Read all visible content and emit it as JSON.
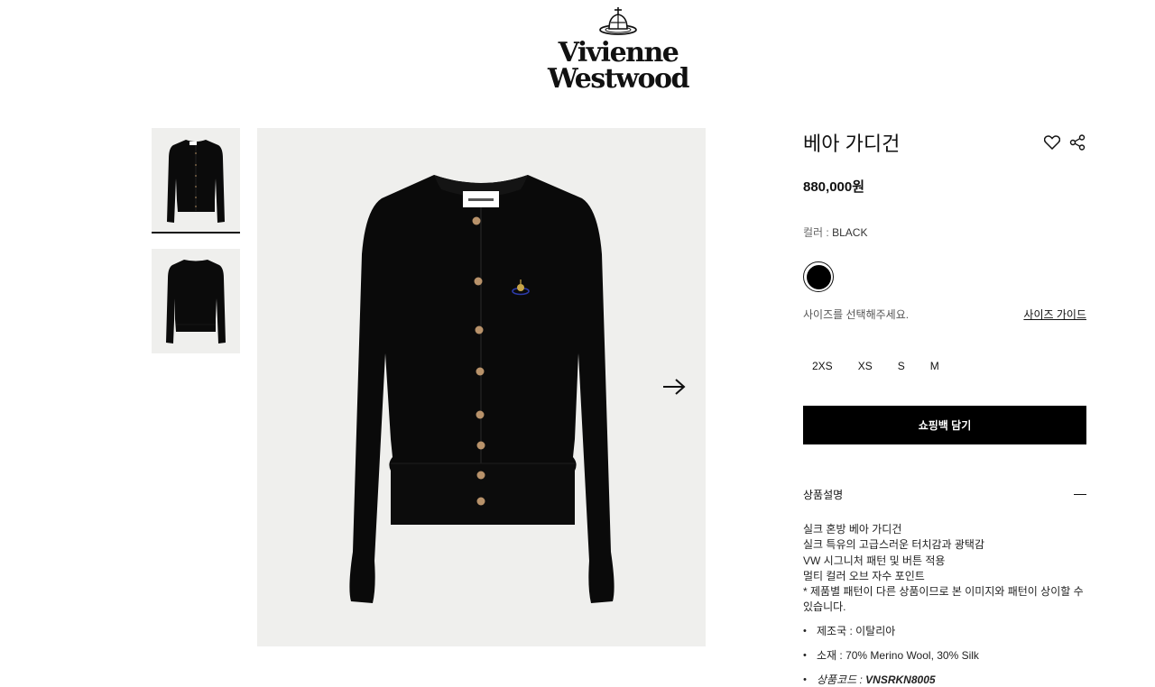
{
  "brand": {
    "logo_line1": "Vivienne",
    "logo_line2": "Westwood",
    "logo_icon": "orb-icon"
  },
  "gallery": {
    "thumbnails": [
      {
        "name": "thumbnail-front",
        "active": true
      },
      {
        "name": "thumbnail-back",
        "active": false
      }
    ],
    "main_image_label": "Vivienne Westwood",
    "next_icon": "arrow-right-icon"
  },
  "product": {
    "title": "베아 가디건",
    "price": "880,000원",
    "color_label": "컬러 : ",
    "color_value": "BLACK",
    "swatch_color": "#000000",
    "size_hint": "사이즈를 선택해주세요.",
    "size_guide": "사이즈 가이드",
    "sizes": [
      "2XS",
      "XS",
      "S",
      "M"
    ],
    "add_to_bag": "쇼핑백 담기",
    "wishlist_icon": "heart-icon",
    "share_icon": "share-icon"
  },
  "description": {
    "heading": "상품설명",
    "lines": [
      "실크 혼방 베아 가디건",
      "실크 특유의 고급스러운 터치감과 광택감",
      "VW 시그니처 패턴 및 버튼 적용",
      "멀티 컬러 오브 자수 포인트",
      "* 제품별 패턴이 다른 상품이므로 본 이미지와 패턴이 상이할 수 있습니다."
    ],
    "origin": "제조국 : 이탈리아",
    "material": "소재 : 70% Merino Wool, 30% Silk",
    "code_label": "상품코드 : ",
    "code_value": "VNSRKN8005"
  }
}
